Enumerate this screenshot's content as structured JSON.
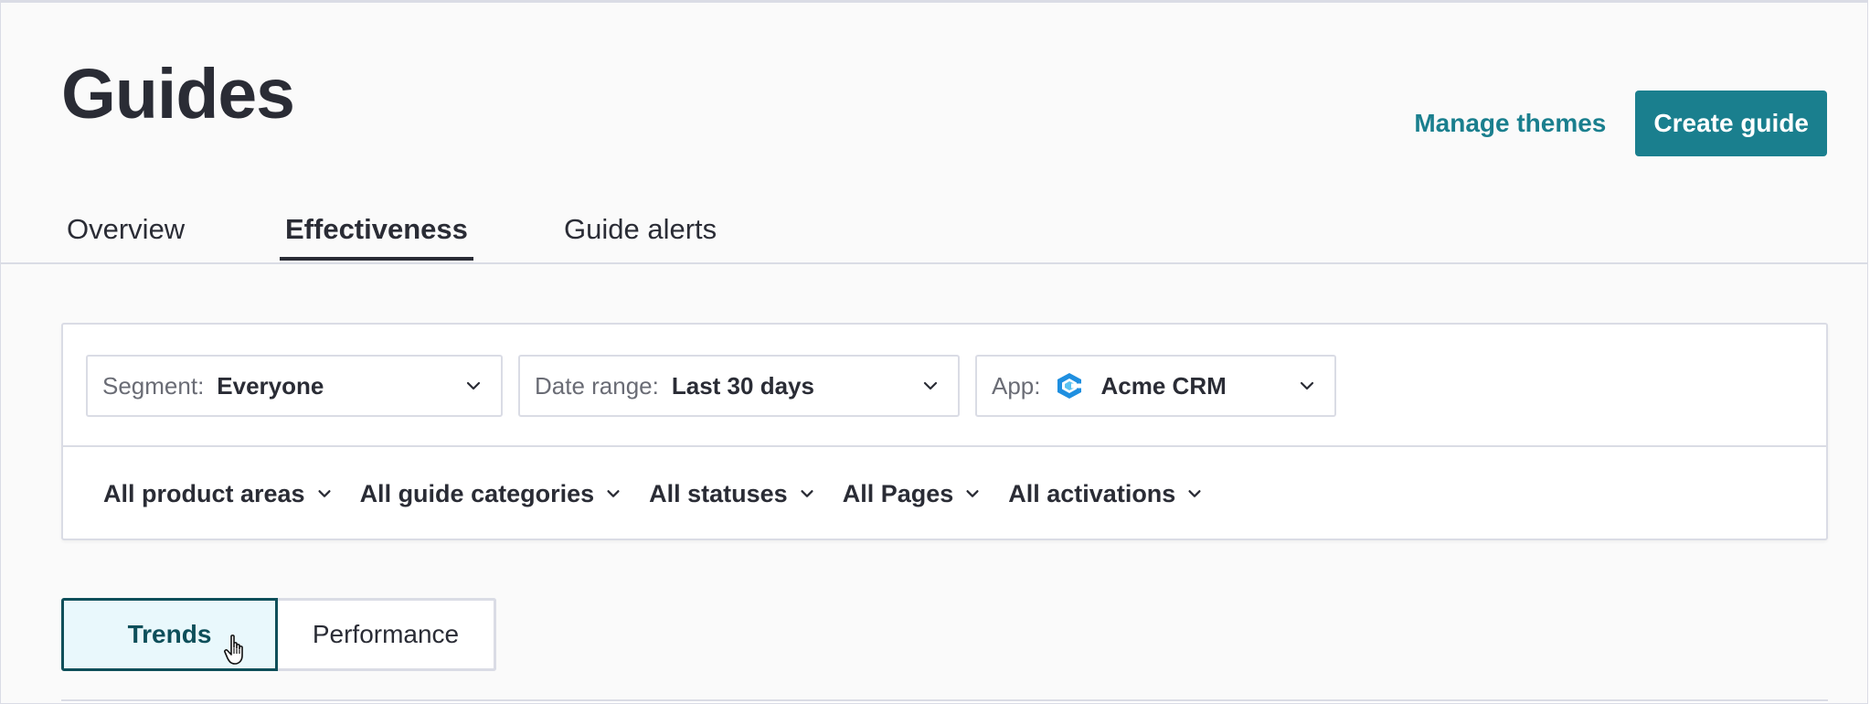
{
  "header": {
    "title": "Guides",
    "manage_themes_label": "Manage themes",
    "create_guide_label": "Create guide"
  },
  "tabs": [
    {
      "label": "Overview",
      "active": false
    },
    {
      "label": "Effectiveness",
      "active": true
    },
    {
      "label": "Guide alerts",
      "active": false
    }
  ],
  "filters": {
    "segment": {
      "label": "Segment:",
      "value": "Everyone"
    },
    "date_range": {
      "label": "Date range:",
      "value": "Last 30 days"
    },
    "app": {
      "label": "App:",
      "value": "Acme CRM",
      "icon": "acme-crm-logo-icon"
    },
    "dropdowns": [
      "All product areas",
      "All guide categories",
      "All statuses",
      "All Pages",
      "All activations"
    ]
  },
  "view_toggle": {
    "options": [
      "Trends",
      "Performance"
    ],
    "selected": "Trends"
  },
  "colors": {
    "accent": "#1a7f8e",
    "text": "#2a2c35",
    "muted": "#6a6c75",
    "border": "#dadce5",
    "toggle_active_bg": "#e9f8fc",
    "toggle_active_border": "#0e4f5a"
  }
}
